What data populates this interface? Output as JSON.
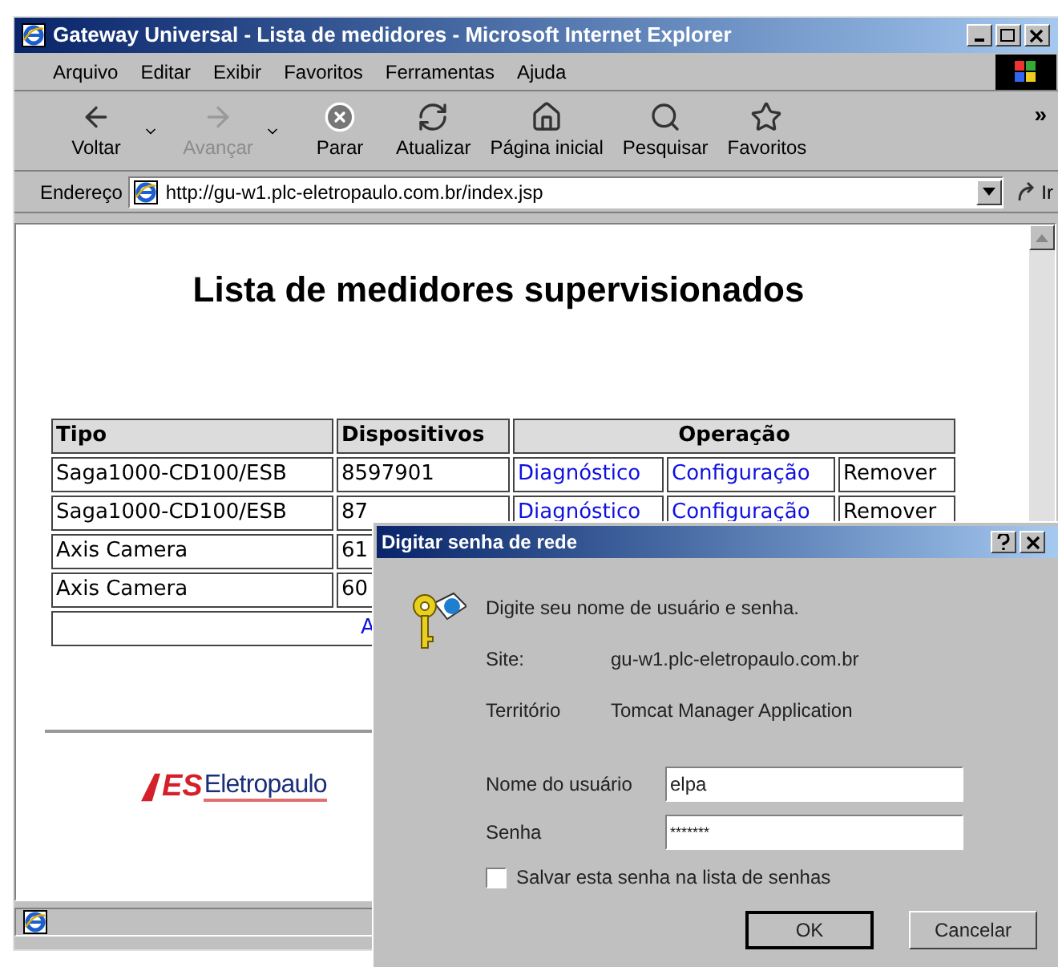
{
  "window": {
    "title": "Gateway Universal - Lista de medidores - Microsoft Internet Explorer"
  },
  "menu": [
    "Arquivo",
    "Editar",
    "Exibir",
    "Favoritos",
    "Ferramentas",
    "Ajuda"
  ],
  "toolbar": [
    {
      "kind": "back",
      "label": "Voltar",
      "disabled": false,
      "dropdown": true
    },
    {
      "kind": "forward",
      "label": "Avançar",
      "disabled": true,
      "dropdown": true
    },
    {
      "kind": "stop",
      "label": "Parar",
      "disabled": false,
      "dropdown": false
    },
    {
      "kind": "refresh",
      "label": "Atualizar",
      "disabled": false,
      "dropdown": false
    },
    {
      "kind": "home",
      "label": "Página inicial",
      "disabled": false,
      "dropdown": false
    },
    {
      "kind": "search",
      "label": "Pesquisar",
      "disabled": false,
      "dropdown": false
    },
    {
      "kind": "favorites",
      "label": "Favoritos",
      "disabled": false,
      "dropdown": false
    }
  ],
  "toolbar_overflow": "»",
  "address": {
    "label": "Endereço",
    "value": "http://gu-w1.plc-eletropaulo.com.br/index.jsp",
    "go": "Ir"
  },
  "page": {
    "heading": "Lista de medidores supervisionados",
    "columns": [
      "Tipo",
      "Dispositivos",
      "Operação"
    ],
    "rows": [
      {
        "tipo": "Saga1000-CD100/ESB",
        "dispositivos": "8597901",
        "operations": [
          {
            "kind": "link",
            "text": "Diagnóstico"
          },
          {
            "kind": "link",
            "text": "Configuração"
          },
          {
            "kind": "text",
            "text": "Remover"
          }
        ]
      },
      {
        "tipo": "Saga1000-CD100/ESB",
        "dispositivos": "87",
        "operations": [
          {
            "kind": "link",
            "text": "Diagnóstico"
          },
          {
            "kind": "link",
            "text": "Configuração"
          },
          {
            "kind": "text",
            "text": "Remover"
          }
        ]
      },
      {
        "tipo": "Axis Camera",
        "dispositivos": "61"
      },
      {
        "tipo": "Axis Camera",
        "dispositivos": "60"
      }
    ],
    "footer_link": "A",
    "logo": {
      "mark": "ES",
      "name": "Eletropaulo"
    }
  },
  "dialog": {
    "title": "Digitar senha de rede",
    "message": "Digite seu nome de usuário e senha.",
    "fields": [
      {
        "label": "Site:",
        "value": "gu-w1.plc-eletropaulo.com.br"
      },
      {
        "label": "Território",
        "value": "Tomcat Manager Application"
      }
    ],
    "username": {
      "label": "Nome do usuário",
      "value": "elpa"
    },
    "password": {
      "label": "Senha",
      "value": "*******"
    },
    "save": {
      "label": "Salvar esta senha na lista de senhas",
      "checked": false
    },
    "buttons": [
      "OK",
      "Cancelar"
    ]
  }
}
